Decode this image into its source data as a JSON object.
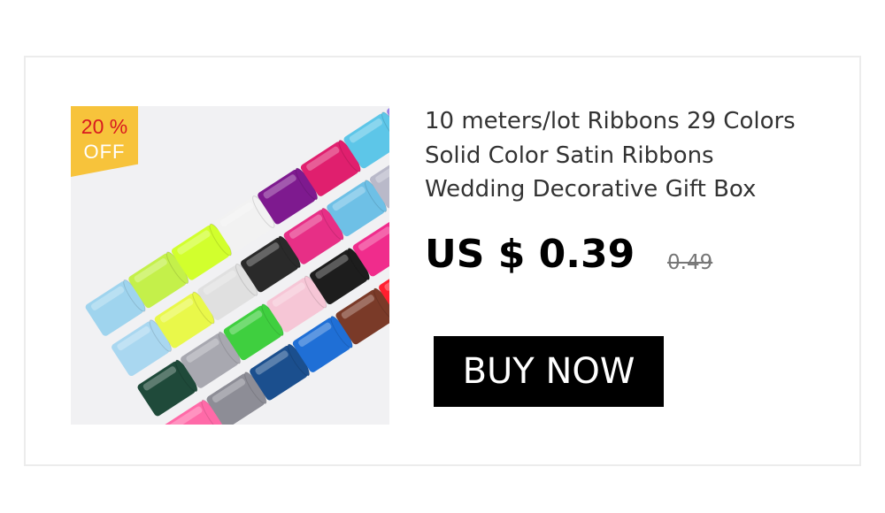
{
  "product": {
    "title_lines": [
      "10 meters/lot Ribbons 29 Colors",
      "Solid Color Satin Ribbons",
      "Wedding Decorative Gift Box"
    ],
    "price": "US $ 0.39",
    "original_price": "0.49",
    "discount": {
      "percent": "20 %",
      "label": "OFF",
      "badge_color": "#f7c33b",
      "percent_color": "#d8191f"
    },
    "buy_button_label": "BUY NOW",
    "image_icon": "ribbon-spools-photo"
  }
}
